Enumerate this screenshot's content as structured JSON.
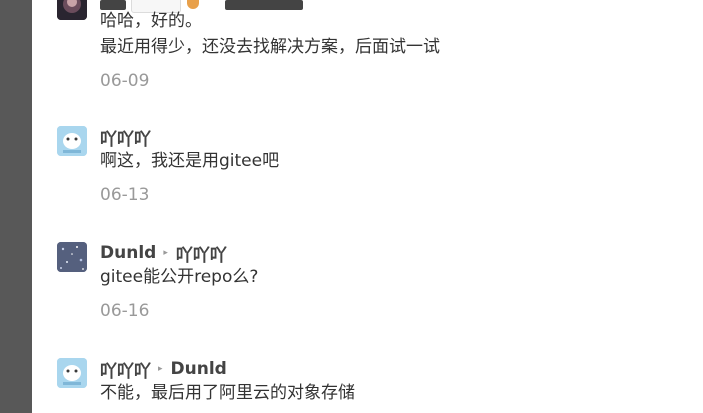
{
  "comments": [
    {
      "names": [
        "",
        "",
        "",
        "",
        "",
        "",
        "",
        "",
        "",
        "",
        "",
        "",
        "",
        "",
        "",
        "",
        "",
        "",
        "",
        "",
        "",
        "",
        "",
        ""
      ],
      "lines": [
        "哈哈，好的。",
        "最近用得少，还没去找解决方案，后面试一试"
      ],
      "date": "06-09"
    },
    {
      "author": "吖吖吖",
      "lines": [
        "啊这，我还是用gitee吧"
      ],
      "date": "06-13"
    },
    {
      "author": "Dunld",
      "reply_to": "吖吖吖",
      "lines": [
        "gitee能公开repo么?"
      ],
      "date": "06-16"
    },
    {
      "author": "吖吖吖",
      "reply_to": "Dunld",
      "lines": [
        "不能，最后用了阿里云的对象存储"
      ],
      "date": ""
    }
  ],
  "reply_arrow": "▸",
  "colors": {
    "sidebar": "#585858",
    "text": "#333333",
    "date": "#999999",
    "avatar_blue": "#a9d6ee"
  }
}
